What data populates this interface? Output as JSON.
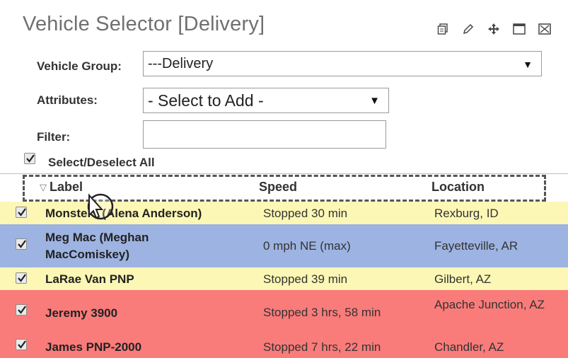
{
  "panel": {
    "title": "Vehicle Selector  [Delivery]",
    "icons": [
      "copy-icon",
      "pencil-icon",
      "move-icon",
      "maximize-icon",
      "close-icon"
    ]
  },
  "form": {
    "vehicle_group_label": "Vehicle Group:",
    "vehicle_group_value": "---Delivery",
    "attributes_label": "Attributes:",
    "attributes_value": "- Select to Add -",
    "filter_label": "Filter:",
    "filter_value": "",
    "select_all_label": "Select/Deselect All",
    "select_all_checked": true
  },
  "table": {
    "columns": [
      "Label",
      "Speed",
      "Location"
    ],
    "sort_indicator": "▽",
    "rows": [
      {
        "label": "Monsters (Alena Anderson)",
        "speed": "Stopped 30 min",
        "location": "Rexburg, ID",
        "checked": true,
        "color": "#fdf7b5"
      },
      {
        "label": "Meg Mac (Meghan MacComiskey)",
        "speed": "0 mph NE (max)",
        "location": "Fayetteville, AR",
        "checked": true,
        "color": "#9db3e2"
      },
      {
        "label": "LaRae Van PNP",
        "speed": "Stopped 39 min",
        "location": "Gilbert, AZ",
        "checked": true,
        "color": "#fdf7b5"
      },
      {
        "label": "Jeremy 3900",
        "speed": "Stopped 3 hrs, 58 min",
        "location": "Apache Junction, AZ",
        "checked": true,
        "color": "#f97c7a"
      },
      {
        "label": "James PNP-2000",
        "speed": "Stopped 7 hrs, 22 min",
        "location": "Chandler, AZ",
        "checked": true,
        "color": "#f97c7a"
      }
    ]
  }
}
